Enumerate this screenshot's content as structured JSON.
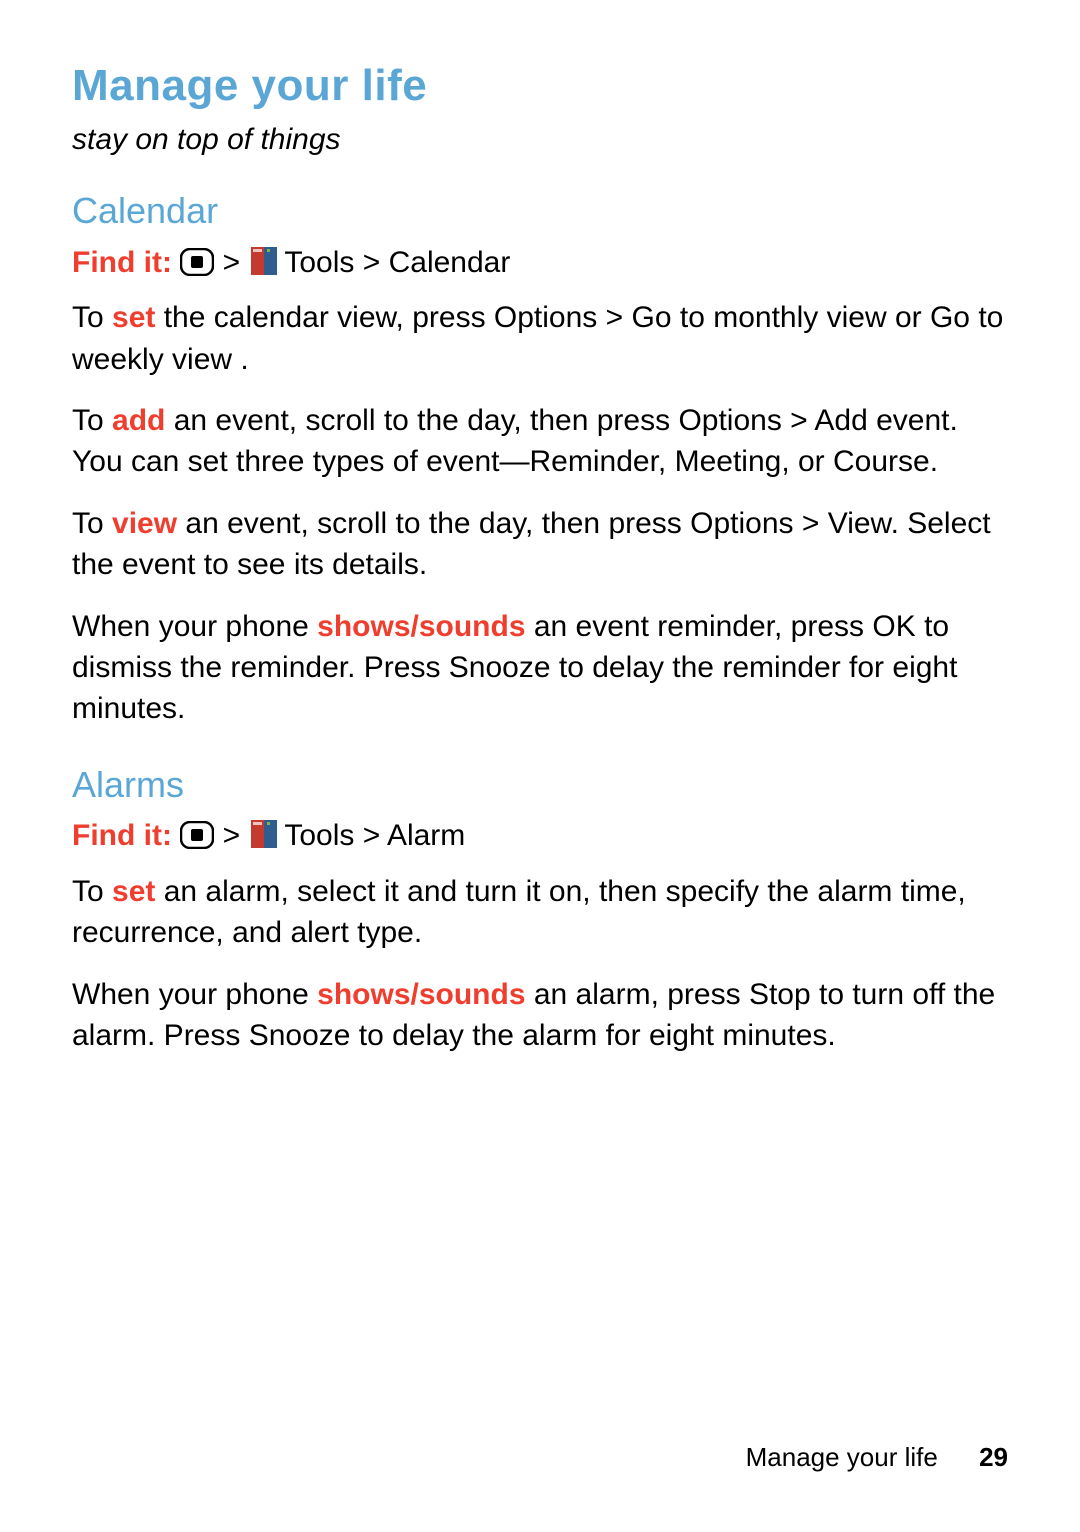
{
  "title": "Manage your life",
  "subtitle": "stay on top of things",
  "findit_label": "Find it:",
  "sep": ">",
  "nav_tools": "Tools",
  "calendar": {
    "heading": "Calendar",
    "nav_target": "Calendar",
    "p1_a": "To ",
    "p1_hl": "set",
    "p1_b": " the calendar view, press ",
    "p1_opt": "Options",
    "p1_c": " > ",
    "p1_v1": "Go to monthly view",
    "p1_d": "   or ",
    "p1_v2": "Go to weekly view",
    "p1_e": "  .",
    "p2_a": "To ",
    "p2_hl": "add",
    "p2_b": " an event, scroll to the day, then press ",
    "p2_opt": "Options",
    "p2_c": " > ",
    "p2_add": "Add event",
    "p2_d": ". You can set three types of event—",
    "p2_t1": "Reminder",
    "p2_s1": ", ",
    "p2_t2": "Meeting",
    "p2_s2": ", or ",
    "p2_t3": "Course",
    "p2_e": ".",
    "p3_a": "To ",
    "p3_hl": "view",
    "p3_b": " an event, scroll to the day, then press ",
    "p3_opt": "Options",
    "p3_c": " > ",
    "p3_view": "View",
    "p3_d": ". Select the event to see its details.",
    "p4_a": "When your phone ",
    "p4_hl": "shows/sounds",
    "p4_b": " an event reminder, press ",
    "p4_ok": "OK",
    "p4_c": " to dismiss the reminder. Press ",
    "p4_sn": "Snooze",
    "p4_d": " to delay the reminder for eight minutes."
  },
  "alarms": {
    "heading": "Alarms",
    "nav_target": "Alarm",
    "p1_a": "To ",
    "p1_hl": "set",
    "p1_b": " an alarm, select it and turn it on, then specify the alarm time, recurrence, and alert type.",
    "p2_a": "When your phone ",
    "p2_hl": "shows/sounds",
    "p2_b": " an alarm, press ",
    "p2_stop": "Stop",
    "p2_c": " to turn off the alarm. Press ",
    "p2_sn": "Snooze",
    "p2_d": " to delay the alarm for eight minutes."
  },
  "footer_text": "Manage your life",
  "page_number": "29"
}
